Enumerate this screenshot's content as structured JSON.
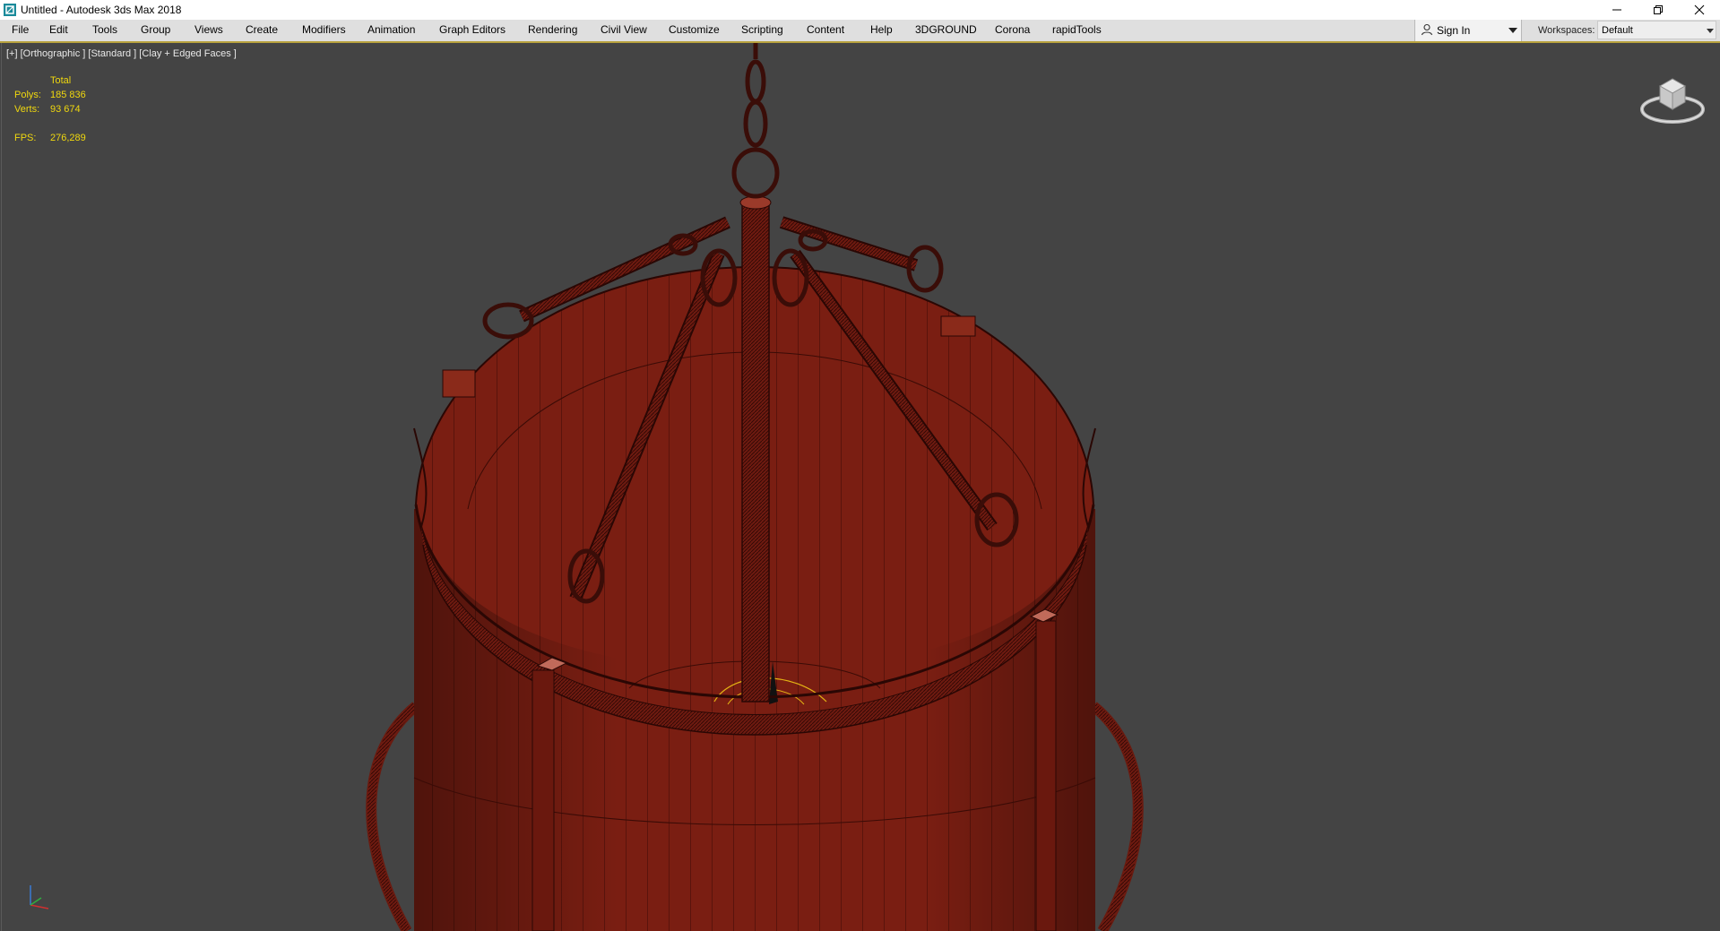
{
  "window": {
    "title": "Untitled - Autodesk 3ds Max 2018"
  },
  "menu": {
    "items": [
      "File",
      "Edit",
      "Tools",
      "Group",
      "Views",
      "Create",
      "Modifiers",
      "Animation",
      "Graph Editors",
      "Rendering",
      "Civil View",
      "Customize",
      "Scripting",
      "Content",
      "Help",
      "3DGROUND",
      "Corona",
      "rapidTools"
    ]
  },
  "account": {
    "sign_in_label": "Sign In"
  },
  "workspaces": {
    "label": "Workspaces:",
    "value": "Default"
  },
  "viewport": {
    "label": "[+] [Orthographic ] [Standard ] [Clay + Edged Faces ]",
    "stats": {
      "header": "Total",
      "polys_label": "Polys:",
      "polys_value": "185 836",
      "verts_label": "Verts:",
      "verts_value": "93 674",
      "fps_label": "FPS:",
      "fps_value": "276,289"
    }
  },
  "colors": {
    "viewport_bg": "#444444",
    "model_fill": "#7a1e12",
    "model_wire": "#3a0b06",
    "stats_text": "#f0d80e",
    "menu_accent": "#b8a23e"
  },
  "icons": {
    "app": "3ds-max-icon",
    "sign_in": "user-icon",
    "viewcube": "viewcube-icon",
    "axis": "axis-tripod-icon"
  }
}
